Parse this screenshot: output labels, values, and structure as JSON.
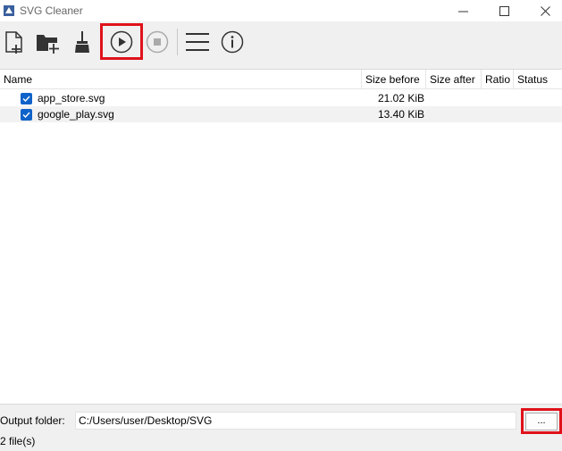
{
  "window": {
    "title": "SVG Cleaner",
    "icon": "svg-cleaner-app-icon",
    "controls": [
      "minimize-icon",
      "maximize-icon",
      "close-icon"
    ]
  },
  "toolbar": {
    "buttons": [
      {
        "name": "add-files",
        "icon": "add-file-icon"
      },
      {
        "name": "add-folder",
        "icon": "add-folder-icon"
      },
      {
        "name": "clear-list",
        "icon": "broom-icon"
      },
      {
        "name": "run",
        "icon": "play-icon",
        "highlighted": true
      },
      {
        "name": "stop",
        "icon": "stop-icon",
        "enabled": false
      },
      {
        "name": "settings",
        "icon": "menu-icon"
      },
      {
        "name": "about",
        "icon": "info-icon"
      }
    ],
    "highlight_color": "#e0121b"
  },
  "table": {
    "headers": {
      "name": "Name",
      "size_before": "Size before",
      "size_after": "Size after",
      "ratio": "Ratio",
      "status": "Status"
    },
    "rows": [
      {
        "checked": true,
        "name": "app_store.svg",
        "size_before": "21.02 KiB",
        "size_after": "",
        "ratio": "",
        "status": ""
      },
      {
        "checked": true,
        "name": "google_play.svg",
        "size_before": "13.40 KiB",
        "size_after": "",
        "ratio": "",
        "status": ""
      }
    ]
  },
  "output": {
    "label": "Output folder:",
    "value": "C:/Users/user/Desktop/SVG",
    "browse_label": "..."
  },
  "status": "2 file(s)",
  "colors": {
    "checkbox": "#0f62c9",
    "highlight": "#e0121b"
  }
}
